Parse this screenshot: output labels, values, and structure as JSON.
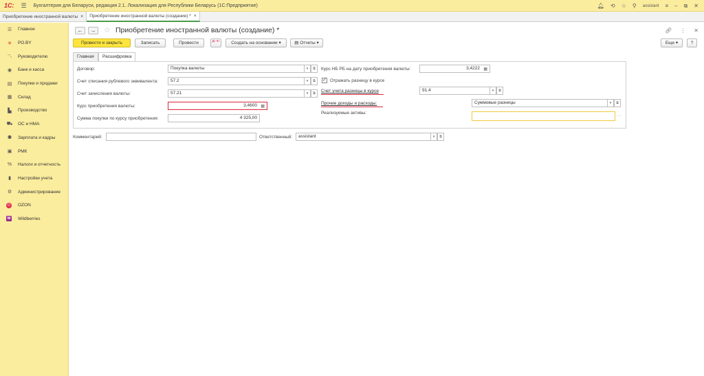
{
  "titlebar": {
    "logo": "1С:",
    "app_title": "Бухгалтерия для Беларуси, редакция 2.1. Локализация для Республики Беларусь   (1С:Предприятие)",
    "user": "assistant"
  },
  "open_tabs": [
    {
      "label": "Приобретение иностранной валюты"
    },
    {
      "label": "Приобретение иностранной валюты (создание) *"
    }
  ],
  "sidebar": {
    "items": [
      {
        "label": "Главное",
        "icon": "menu-icon"
      },
      {
        "label": "РО.BY",
        "icon": "snowflake-icon"
      },
      {
        "label": "Руководителю",
        "icon": "chart-line-icon"
      },
      {
        "label": "Банк и касса",
        "icon": "coin-icon"
      },
      {
        "label": "Покупки и продажи",
        "icon": "cart-icon"
      },
      {
        "label": "Склад",
        "icon": "warehouse-icon"
      },
      {
        "label": "Производство",
        "icon": "factory-icon"
      },
      {
        "label": "ОС и НМА",
        "icon": "truck-icon"
      },
      {
        "label": "Зарплата и кадры",
        "icon": "person-icon"
      },
      {
        "label": "РМК",
        "icon": "register-icon"
      },
      {
        "label": "Налоги и отчетность",
        "icon": "percent-icon"
      },
      {
        "label": "Настройки учета",
        "icon": "settings-doc-icon"
      },
      {
        "label": "Администрирование",
        "icon": "gear-icon"
      },
      {
        "label": "OZON",
        "icon": "ozon-icon"
      },
      {
        "label": "Wildberries",
        "icon": "wildberries-icon"
      }
    ]
  },
  "document": {
    "title": "Приобретение иностранной валюты (создание) *"
  },
  "toolbar": {
    "post_close": "Провести и закрыть",
    "save": "Записать",
    "post": "Провести",
    "dt_kt": "Дт Кт",
    "create_based": "Создать на основании",
    "reports": "Отчеты",
    "more": "Еще",
    "help": "?"
  },
  "form_tabs": {
    "main": "Главная",
    "details": "Расшифровка"
  },
  "form": {
    "contract_label": "Договор:",
    "contract_value": "Покупка валюты",
    "debit_account_label": "Счет списания рублевого эквивалента:",
    "debit_account_value": "57.2",
    "credit_account_label": "Счет зачисления валюты:",
    "credit_account_value": "57.21",
    "rate_label": "Курс приобретения валюты:",
    "rate_value": "3,4600",
    "sum_label": "Сумма покупки  по курсу приобретения:",
    "sum_value": "4 325,00",
    "nb_rate_label": "Курс НБ РБ на дату приобретения валюты:",
    "nb_rate_value": "3,4222",
    "reflect_diff_label": "Отражать разницу в курсе",
    "reflect_diff_checked": true,
    "diff_account_label": "Счет учета разницы в курсе",
    "diff_account_value": "91.4",
    "other_income_label": "Прочие доходы и расходы:",
    "other_income_value": "Суммовые разницы",
    "sold_assets_label": "Реализуемые активы:",
    "sold_assets_value": "",
    "comment_label": "Комментарий:",
    "comment_value": "",
    "responsible_label": "Ответственный:",
    "responsible_value": "assistant"
  }
}
